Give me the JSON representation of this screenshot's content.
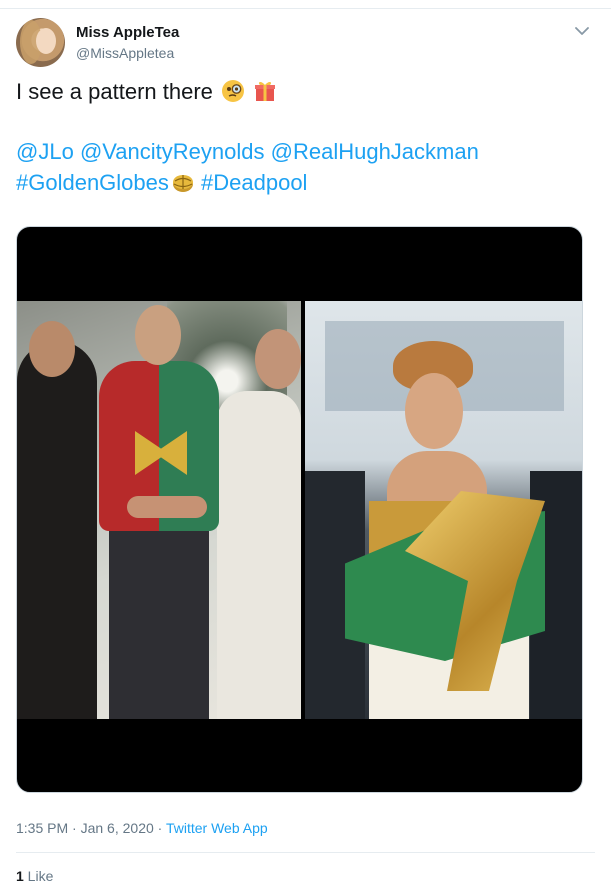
{
  "user": {
    "display_name": "Miss AppleTea",
    "handle": "@MissAppletea"
  },
  "tweet": {
    "text_line1": "I see a pattern there",
    "emoji_line1": [
      "monocle-face-emoji",
      "gift-emoji"
    ],
    "mentions": [
      "@JLo",
      "@VancityReynolds",
      "@RealHughJackman"
    ],
    "hashtags": [
      "#GoldenGlobes",
      "#Deadpool"
    ],
    "hashtag_emoji": "golden-globe-emoji"
  },
  "media": {
    "left_photo": "photo-men-christmas-sweater",
    "right_photo": "photo-woman-gold-green-bow-gown"
  },
  "meta": {
    "time": "1:35 PM",
    "date": "Jan 6, 2020",
    "separator": " · ",
    "source": "Twitter Web App"
  },
  "stats": {
    "like_count": "1",
    "like_label": " Like"
  },
  "colors": {
    "link": "#1da1f2",
    "secondary": "#657786",
    "border": "#e6ecf0"
  }
}
